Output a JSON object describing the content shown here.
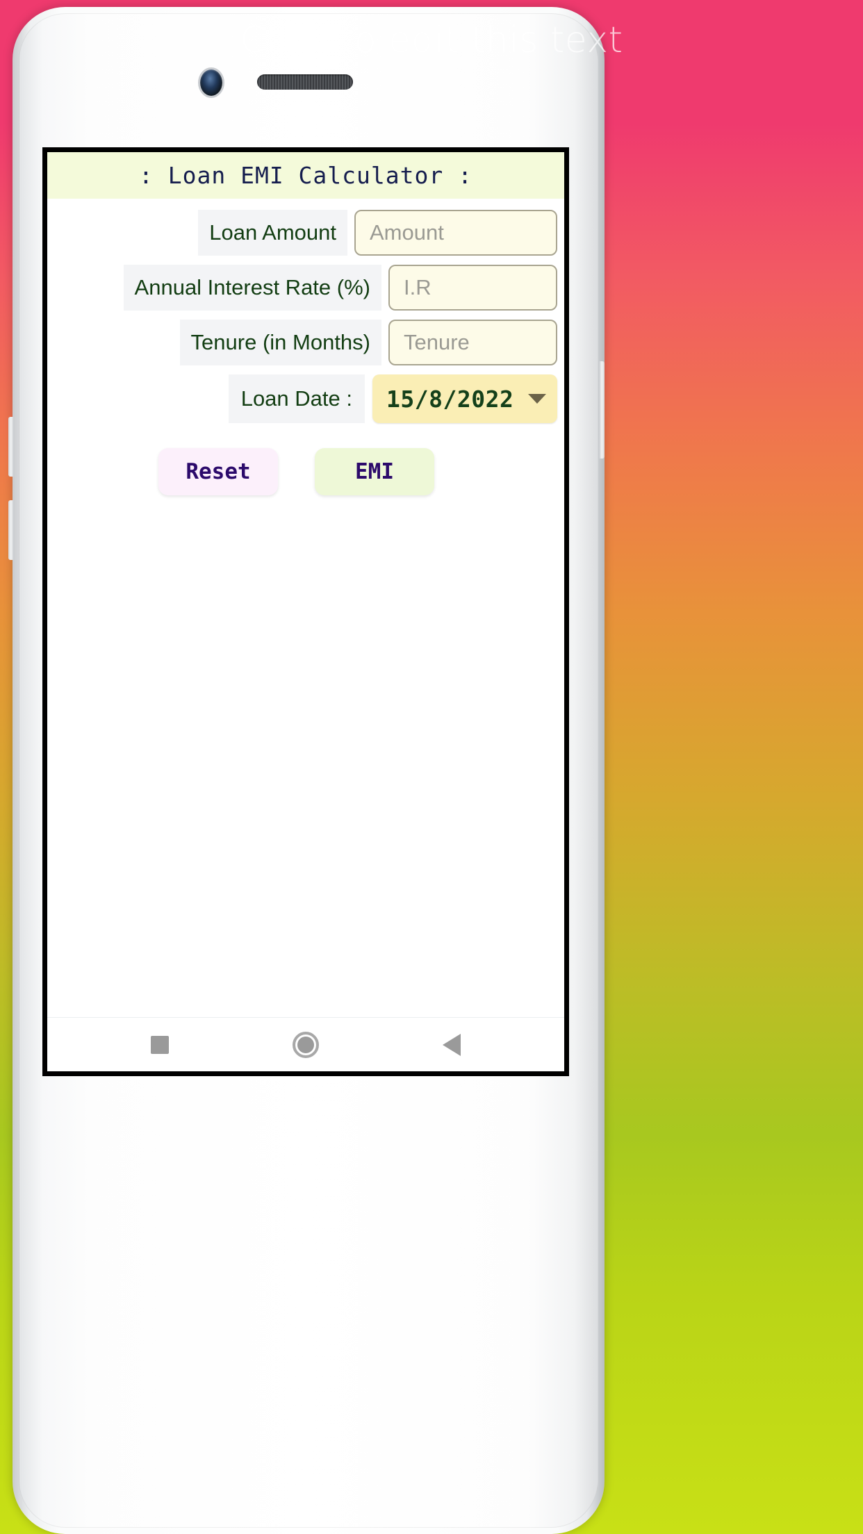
{
  "mockup": {
    "caption": "Click to edit this text",
    "camera_icon": "camera-lens-icon",
    "speaker_icon": "earpiece-speaker-icon",
    "background_gradient": [
      "#ef3a6e",
      "#ef7a4a",
      "#d6a82e",
      "#c8e016"
    ],
    "body_color": "#ffffff"
  },
  "app": {
    "title": ": Loan EMI Calculator :",
    "title_bar_color": "#f4fada",
    "title_text_color": "#151d4e",
    "screen_background": "#ffffff",
    "fields": [
      {
        "label": "Loan Amount",
        "placeholder": "Amount",
        "value": "",
        "input_bg": "#fdfbe8",
        "input_border": "#a8a490"
      },
      {
        "label": "Annual Interest Rate (%)",
        "placeholder": "I.R",
        "value": "",
        "input_bg": "#fdfbe8",
        "input_border": "#a8a490"
      },
      {
        "label": "Tenure (in Months)",
        "placeholder": "Tenure",
        "value": "",
        "input_bg": "#fdfbe8",
        "input_border": "#a8a490"
      }
    ],
    "date_field": {
      "label": "Loan Date :",
      "value": "15/8/2022",
      "chevron_icon": "chevron-down-icon",
      "dropdown_bg": "#faeeb5",
      "value_color": "#14401a"
    },
    "buttons": [
      {
        "label": "Reset",
        "bg": "#fcf0fb",
        "text_color": "#2c0a6b"
      },
      {
        "label": "EMI",
        "bg": "#eef8d7",
        "text_color": "#2c0a6b"
      }
    ],
    "label_bg": "#f3f4f6",
    "label_text_color": "#123d12"
  },
  "nav_bar": {
    "recents_icon": "square-recents-icon",
    "home_icon": "circle-home-icon",
    "back_icon": "triangle-back-icon",
    "icon_color": "#9a9a9a"
  }
}
